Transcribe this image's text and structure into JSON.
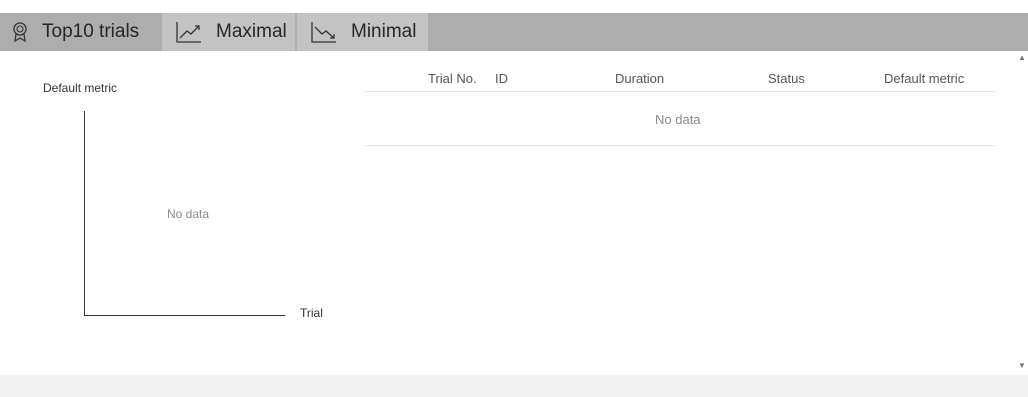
{
  "tabs": [
    {
      "label": "Top10 trials",
      "icon": "ribbon-icon"
    },
    {
      "label": "Maximal",
      "icon": "trend-up-icon"
    },
    {
      "label": "Minimal",
      "icon": "trend-down-icon"
    }
  ],
  "chart": {
    "ylabel": "Default metric",
    "xlabel": "Trial",
    "empty_text": "No data"
  },
  "table": {
    "columns": [
      "Trial No.",
      "ID",
      "Duration",
      "Status",
      "Default metric"
    ],
    "empty_text": "No data"
  },
  "colors": {
    "tabbar_bg": "#adadad",
    "tab_inactive_bg": "#c3c3c3",
    "footer_bg": "#f2f2f2"
  }
}
